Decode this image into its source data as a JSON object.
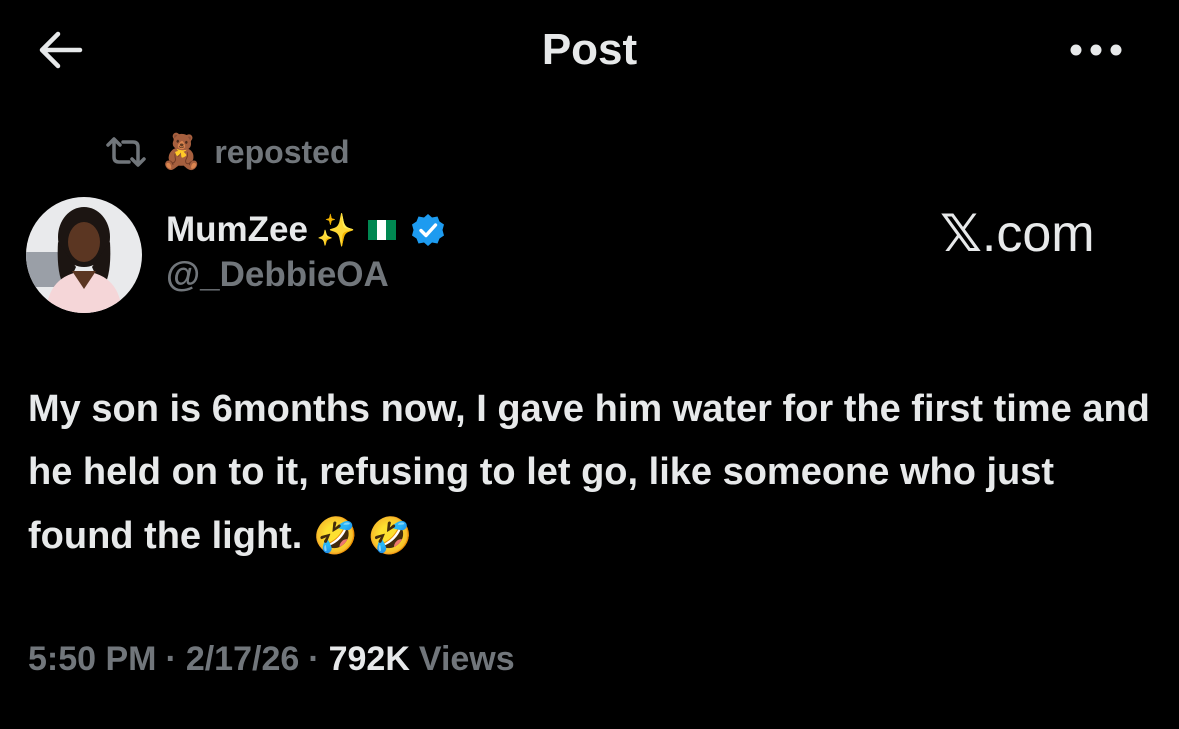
{
  "header": {
    "title": "Post",
    "back_icon": "arrow-left-icon",
    "more_icon": "more-horizontal-icon"
  },
  "repost": {
    "icon": "repost-icon",
    "reposter_emoji": "🧸",
    "label": "reposted"
  },
  "author": {
    "display_name": "MumZee",
    "name_emoji": "✨",
    "flag": "Nigeria flag",
    "verified_icon": "verified-badge-icon",
    "handle": "@_DebbieOA"
  },
  "watermark": {
    "mark": "𝕏",
    "text": ".com"
  },
  "post": {
    "text": "My son is 6months now, I gave him water for the first time and he held on to it, refusing to let go, like someone who just found the light.",
    "emojis": "🤣 🤣"
  },
  "meta": {
    "time": "5:50 PM",
    "separator": "·",
    "date": "2/17/26",
    "views_count": "792K",
    "views_label": "Views"
  },
  "colors": {
    "background": "#000000",
    "text": "#e7e9ea",
    "secondary": "#71767b",
    "verified": "#1d9bf0",
    "flag_green": "#008751"
  }
}
